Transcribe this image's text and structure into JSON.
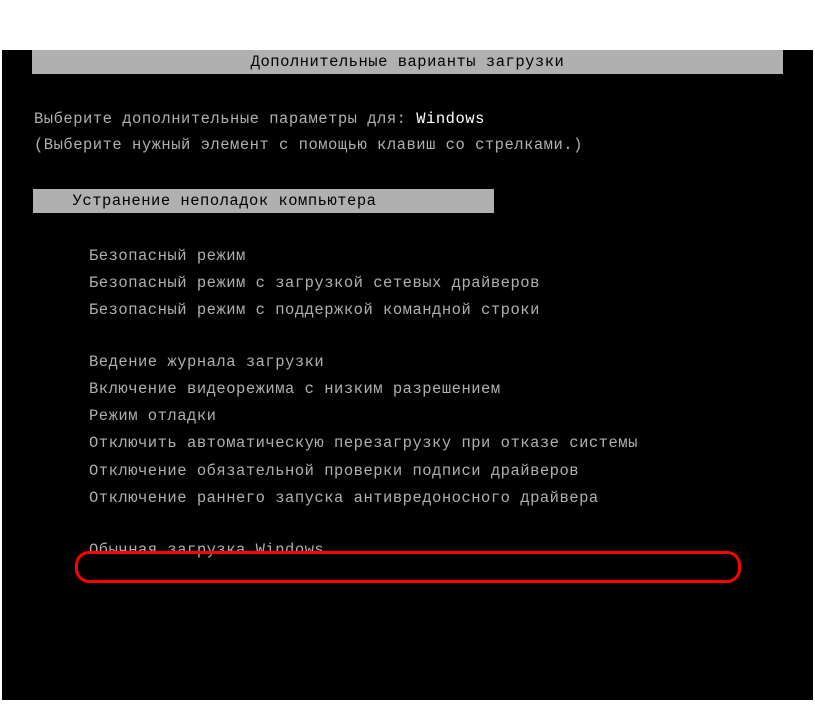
{
  "title": "Дополнительные варианты загрузки",
  "instruction": {
    "line1_prefix": "Выберите дополнительные параметры для: ",
    "os_name": "Windows",
    "line2": "(Выберите нужный элемент с помощью клавиш со стрелками.)"
  },
  "selected_option": "Устранение неполадок компьютера",
  "group1": {
    "item1": "Безопасный режим",
    "item2": "Безопасный режим с загрузкой сетевых драйверов",
    "item3": "Безопасный режим с поддержкой командной строки"
  },
  "group2": {
    "item1": "Ведение журнала загрузки",
    "item2": "Включение видеорежима с низким разрешением",
    "item3": "Режим отладки",
    "item4": "Отключить автоматическую перезагрузку при отказе системы",
    "item5": "Отключение обязательной проверки подписи драйверов",
    "item6": "Отключение раннего запуска антивредоносного драйвера"
  },
  "group3": {
    "item1": "Обычная загрузка Windows"
  }
}
